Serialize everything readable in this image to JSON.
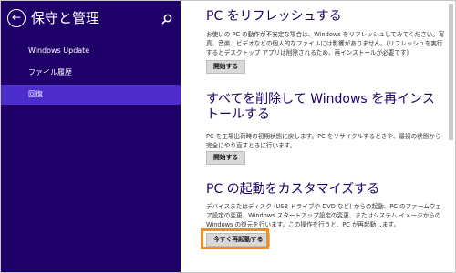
{
  "sidebar": {
    "title": "保守と管理",
    "back_icon_glyph": "←",
    "items": [
      {
        "label": "Windows Update"
      },
      {
        "label": "ファイル履歴"
      },
      {
        "label": "回復",
        "selected": true
      }
    ]
  },
  "sections": [
    {
      "heading": "PC をリフレッシュする",
      "body": "お使いの PC の動作が不安定な場合は、Windows をリフレッシュしてみてください。写真、音楽、ビデオなどの個人的なファイルには影響がありません。(リフレッシュを実行するとデスクトップ アプリは削除されるため、再インストールが必要です)",
      "button": "開始する"
    },
    {
      "heading": "すべてを削除して Windows を再インストールする",
      "body": "PC を工場出荷時の初期状態に戻します。PC をリサイクルするときや、最初の状態から完全にやり直すときに行います。",
      "button": "開始する"
    },
    {
      "heading": "PC の起動をカスタマイズする",
      "body": "デバイスまたはディスク (USB ドライブや DVD など) からの起動、PC のファームウェア設定の変更、Windows スタートアップ設定の変更、またはシステム イメージからの Windows の復元を行います。この操作を行うと、PC が再起動します。",
      "button": "今すぐ再起動する"
    }
  ],
  "colors": {
    "sidebar_bg": "#1f0068",
    "selected_bg": "#4c2dcb",
    "heading": "#1f0068",
    "highlight": "#f09020"
  }
}
